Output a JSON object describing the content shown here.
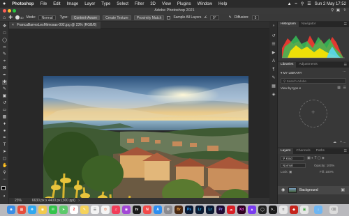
{
  "menubar": {
    "apple": "",
    "app_name": "Photoshop",
    "items": [
      "File",
      "Edit",
      "Image",
      "Layer",
      "Type",
      "Select",
      "Filter",
      "3D",
      "View",
      "Plugins",
      "Window",
      "Help"
    ],
    "clock": "Sun 2 May  17:52"
  },
  "window": {
    "title": "Adobe Photoshop 2021"
  },
  "options": {
    "brush_size": "40",
    "mode_label": "Mode:",
    "mode_value": "Normal",
    "type_label": "Type:",
    "type_content_aware": "Content-Aware",
    "type_create_texture": "Create Texture",
    "type_proximity_match": "Proximity Match",
    "sample_all_layers": "Sample All Layers",
    "angle": "0°",
    "diffusion_label": "Diffusion:",
    "diffusion_value": "5"
  },
  "document": {
    "tab_title": "FrancaBarresLesMimosas-002.jpg @ 23% (RGB/8)",
    "zoom": "23%",
    "info": "6630 px x 4400 px (300 ppi)"
  },
  "histogram": {
    "tab_active": "Histogram",
    "tab_other": "Navigator",
    "colors": {
      "red": "#ff3b30",
      "green": "#34c759",
      "yellow": "#ffe600",
      "cyan": "#5ad8f0"
    }
  },
  "libraries": {
    "tab_active": "Libraries",
    "tab_other": "Adjustments",
    "library_name": "MY LIBRARY",
    "search_placeholder": "Search Adobe",
    "view_by": "View by type"
  },
  "layers": {
    "tab_active": "Layers",
    "tab_channels": "Channels",
    "tab_paths": "Paths",
    "kind_label": "Kind",
    "blend_mode": "Normal",
    "opacity_label": "Opacity:",
    "opacity_value": "100%",
    "lock_label": "Lock:",
    "fill_label": "Fill:",
    "fill_value": "100%",
    "layer_name": "Background"
  },
  "accent": "#1473e6"
}
